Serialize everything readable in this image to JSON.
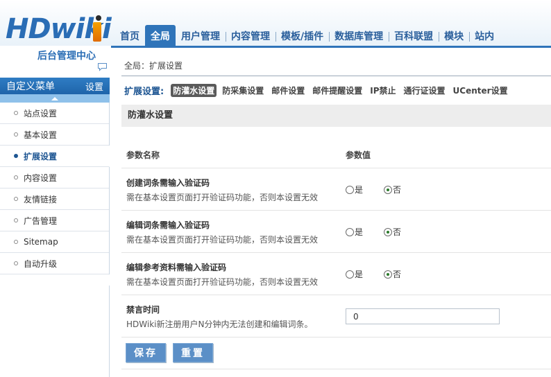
{
  "brand": {
    "logo_text": "HDwiki",
    "subtitle": "后台管理中心",
    "accent": "#2f74b9"
  },
  "topnav": {
    "items": [
      {
        "label": "首页"
      },
      {
        "label": "全局",
        "active": true
      },
      {
        "label": "用户管理"
      },
      {
        "label": "内容管理"
      },
      {
        "label": "模板/插件"
      },
      {
        "label": "数据库管理"
      },
      {
        "label": "百科联盟"
      },
      {
        "label": "模块"
      },
      {
        "label": "站内"
      }
    ]
  },
  "sidebar": {
    "title": "自定义菜单",
    "settings_label": "设置",
    "items": [
      {
        "label": "站点设置"
      },
      {
        "label": "基本设置"
      },
      {
        "label": "扩展设置",
        "active": true
      },
      {
        "label": "内容设置"
      },
      {
        "label": "友情链接"
      },
      {
        "label": "广告管理"
      },
      {
        "label": "Sitemap"
      },
      {
        "label": "自动升级"
      }
    ]
  },
  "main": {
    "breadcrumb": "全局：扩展设置",
    "subnav": {
      "label": "扩展设置:",
      "tabs": [
        {
          "label": "防灌水设置",
          "active": true
        },
        {
          "label": "防采集设置"
        },
        {
          "label": "邮件设置"
        },
        {
          "label": "邮件提醒设置"
        },
        {
          "label": "IP禁止"
        },
        {
          "label": "通行证设置"
        },
        {
          "label": "UCenter设置"
        }
      ]
    },
    "panel_title": "防灌水设置",
    "table": {
      "headers": [
        "参数名称",
        "参数值"
      ],
      "rows": [
        {
          "name": "创建词条需输入验证码",
          "desc": "需在基本设置页面打开验证码功能，否则本设置无效",
          "yes": "是",
          "no": "否",
          "selected": "no"
        },
        {
          "name": "编辑词条需输入验证码",
          "desc": "需在基本设置页面打开验证码功能，否则本设置无效",
          "yes": "是",
          "no": "否",
          "selected": "no"
        },
        {
          "name": "编辑参考资料需输入验证码",
          "desc": "需在基本设置页面打开验证码功能，否则本设置无效",
          "yes": "是",
          "no": "否",
          "selected": "no"
        }
      ],
      "mute": {
        "name": "禁言时间",
        "desc": "HDWiki新注册用户N分钟内无法创建和编辑词条。",
        "value": "0"
      }
    },
    "buttons": {
      "save": "保存",
      "reset": "重置"
    }
  }
}
